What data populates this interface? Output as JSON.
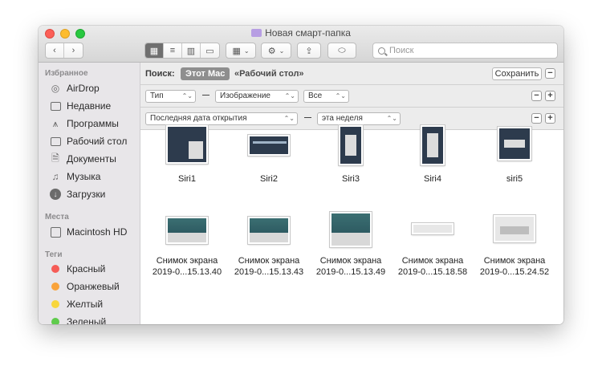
{
  "window": {
    "title": "Новая смарт-папка"
  },
  "toolbar": {
    "view_icons": [
      "grid-icon",
      "list-icon",
      "columns-icon",
      "gallery-icon"
    ],
    "group_label": "⌘",
    "search_placeholder": "Поиск"
  },
  "sidebar": {
    "favorites_header": "Избранное",
    "favorites": [
      {
        "label": "AirDrop",
        "icon": "airdrop-icon"
      },
      {
        "label": "Недавние",
        "icon": "recents-icon"
      },
      {
        "label": "Программы",
        "icon": "applications-icon"
      },
      {
        "label": "Рабочий стол",
        "icon": "desktop-icon"
      },
      {
        "label": "Документы",
        "icon": "documents-icon"
      },
      {
        "label": "Музыка",
        "icon": "music-icon"
      },
      {
        "label": "Загрузки",
        "icon": "downloads-icon"
      }
    ],
    "places_header": "Места",
    "places": [
      {
        "label": "Macintosh HD",
        "icon": "disk-icon"
      }
    ],
    "tags_header": "Теги",
    "tags": [
      {
        "label": "Красный",
        "color": "#f65c57"
      },
      {
        "label": "Оранжевый",
        "color": "#f9a33b"
      },
      {
        "label": "Желтый",
        "color": "#f8d63c"
      },
      {
        "label": "Зеленый",
        "color": "#5fcb4c"
      }
    ]
  },
  "scope": {
    "label": "Поиск:",
    "active": "Этот Mac",
    "other": "«Рабочий стол»",
    "save_label": "Сохранить"
  },
  "rules": [
    {
      "attribute": "Тип",
      "operator": "Изображение",
      "value": "Все"
    },
    {
      "attribute": "Последняя дата открытия",
      "operator": "эта неделя"
    }
  ],
  "files_row1": [
    {
      "name": "Siri1"
    },
    {
      "name": "Siri2"
    },
    {
      "name": "Siri3"
    },
    {
      "name": "Siri4"
    },
    {
      "name": "siri5"
    }
  ],
  "files_row2": [
    {
      "line1": "Снимок экрана",
      "line2": "2019-0...15.13.40"
    },
    {
      "line1": "Снимок экрана",
      "line2": "2019-0...15.13.43"
    },
    {
      "line1": "Снимок экрана",
      "line2": "2019-0...15.13.49"
    },
    {
      "line1": "Снимок экрана",
      "line2": "2019-0...15.18.58"
    },
    {
      "line1": "Снимок экрана",
      "line2": "2019-0...15.24.52"
    }
  ]
}
